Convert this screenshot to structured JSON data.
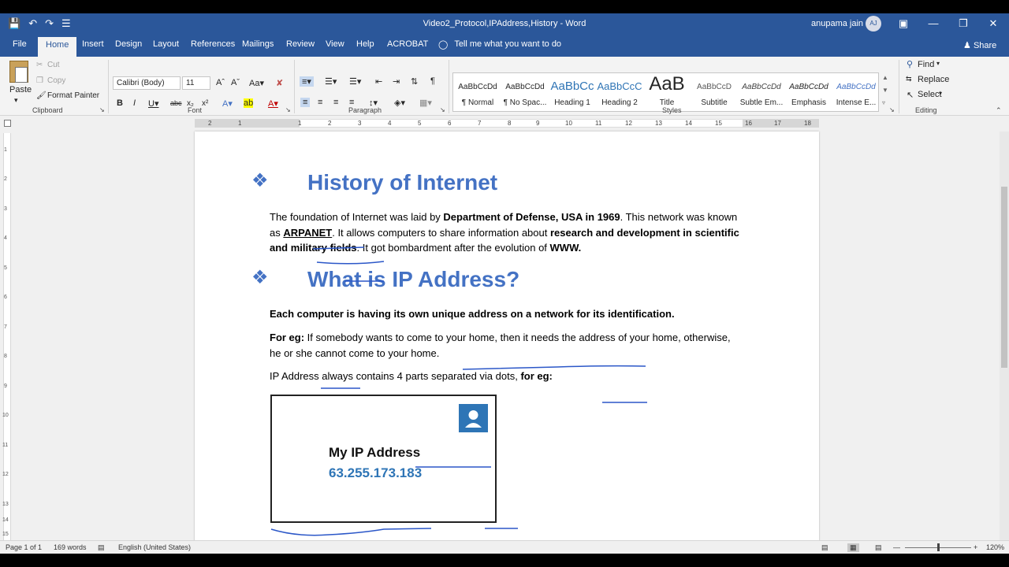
{
  "window": {
    "doc_title": "Video2_Protocol,IPAddress,History  -  Word",
    "user_name": "anupama jain",
    "user_initials": "AJ"
  },
  "tabs": [
    "File",
    "Home",
    "Insert",
    "Design",
    "Layout",
    "References",
    "Mailings",
    "Review",
    "View",
    "Help",
    "ACROBAT"
  ],
  "tell_me": "Tell me what you want to do",
  "share_label": "Share",
  "ribbon": {
    "clipboard": {
      "paste": "Paste",
      "cut": "Cut",
      "copy": "Copy",
      "format_painter": "Format Painter",
      "label": "Clipboard"
    },
    "font": {
      "font_name": "Calibri (Body)",
      "font_size": "11",
      "label": "Font"
    },
    "paragraph": {
      "label": "Paragraph"
    },
    "styles": {
      "label": "Styles",
      "items": [
        {
          "preview": "AaBbCcDd",
          "label": "¶ Normal"
        },
        {
          "preview": "AaBbCcDd",
          "label": "¶ No Spac..."
        },
        {
          "preview": "AaBbCc",
          "label": "Heading 1"
        },
        {
          "preview": "AaBbCcC",
          "label": "Heading 2"
        },
        {
          "preview": "AaB",
          "label": "Title"
        },
        {
          "preview": "AaBbCcD",
          "label": "Subtitle"
        },
        {
          "preview": "AaBbCcDd",
          "label": "Subtle Em..."
        },
        {
          "preview": "AaBbCcDd",
          "label": "Emphasis"
        },
        {
          "preview": "AaBbCcDd",
          "label": "Intense E..."
        }
      ]
    },
    "editing": {
      "find": "Find",
      "replace": "Replace",
      "select": "Select",
      "label": "Editing"
    }
  },
  "document": {
    "heading1": "History of Internet",
    "para1_pre": "The foundation of Internet was laid by ",
    "para1_b1": "Department of Defense, USA in 1969",
    "para1_mid1": ". This network was known as ",
    "para1_b2": "ARPANET",
    "para1_mid2": ". It allows computers to share information about ",
    "para1_b3": "research and development in scientific and military fields",
    "para1_mid3": ". It got bombardment after the evolution of ",
    "para1_b4": "WWW.",
    "heading2": "What is IP Address?",
    "para2": "Each computer is having its own unique address on a network for its identification.",
    "para3_b": "For eg:",
    "para3": " If somebody wants to come to your home, then it needs the address of your home, otherwise, he or she cannot come to your home.",
    "para4_pre": "IP Address always contains 4 parts separated via dots, ",
    "para4_b": "for eg:",
    "ip_card_title": "My IP Address",
    "ip_card_value": "63.255.173.183"
  },
  "status": {
    "page": "Page 1 of 1",
    "words": "169 words",
    "language": "English (United States)",
    "zoom": "120%"
  },
  "ruler_numbers": [
    "2",
    "1",
    "1",
    "2",
    "3",
    "4",
    "5",
    "6",
    "7",
    "8",
    "9",
    "10",
    "11",
    "12",
    "13",
    "14",
    "15",
    "16",
    "17",
    "18"
  ],
  "vruler_numbers": [
    "1",
    "2",
    "3",
    "4",
    "5",
    "6",
    "7",
    "8",
    "9",
    "10",
    "11",
    "12",
    "13",
    "14",
    "15"
  ]
}
